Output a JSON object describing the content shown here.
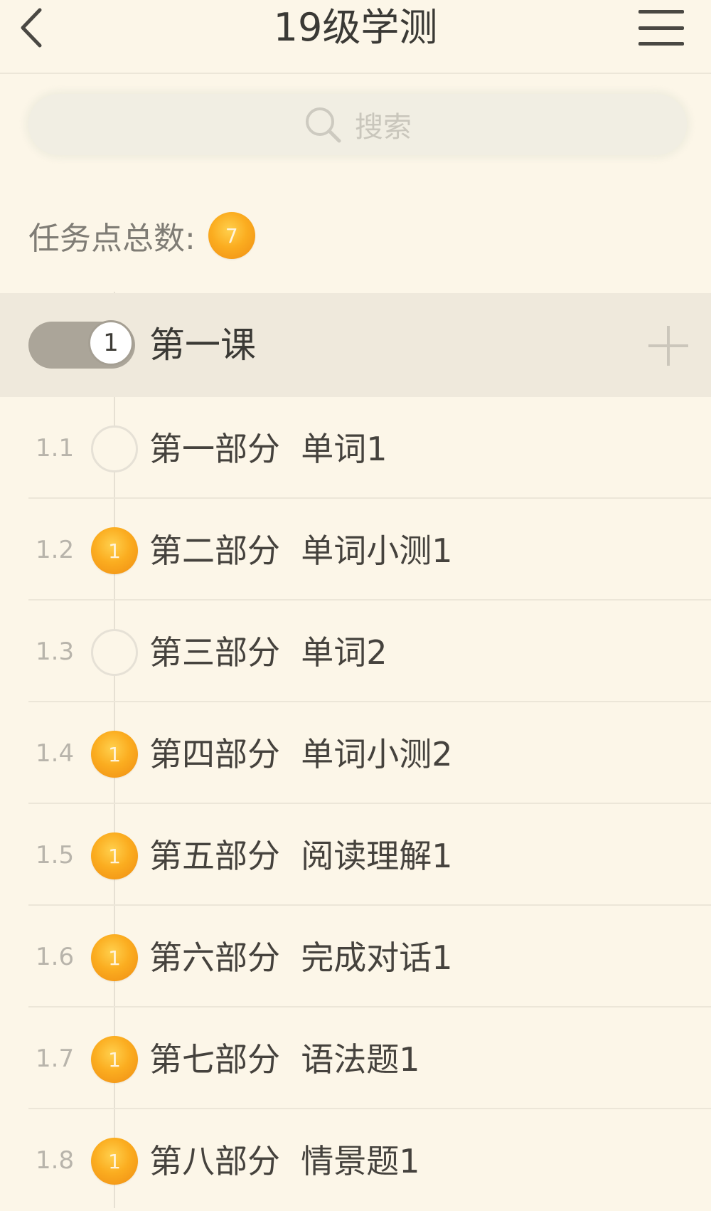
{
  "header": {
    "title": "19级学测",
    "back_icon": "chevron-left-icon",
    "menu_icon": "hamburger-menu-icon"
  },
  "search": {
    "placeholder": "搜索",
    "icon": "search-icon"
  },
  "task_total": {
    "label": "任务点总数:",
    "count": "7"
  },
  "chapter": {
    "number": "1",
    "title": "第一课",
    "expanded": true,
    "add_icon": "plus-icon"
  },
  "lessons": [
    {
      "num": "1.1",
      "title": "第一部分  单词1",
      "task": false,
      "badge": ""
    },
    {
      "num": "1.2",
      "title": "第二部分  单词小测1",
      "task": true,
      "badge": "1"
    },
    {
      "num": "1.3",
      "title": "第三部分  单词2",
      "task": false,
      "badge": ""
    },
    {
      "num": "1.4",
      "title": "第四部分  单词小测2",
      "task": true,
      "badge": "1"
    },
    {
      "num": "1.5",
      "title": "第五部分  阅读理解1",
      "task": true,
      "badge": "1"
    },
    {
      "num": "1.6",
      "title": "第六部分  完成对话1",
      "task": true,
      "badge": "1"
    },
    {
      "num": "1.7",
      "title": "第七部分  语法题1",
      "task": true,
      "badge": "1"
    },
    {
      "num": "1.8",
      "title": "第八部分  情景题1",
      "task": true,
      "badge": "1"
    }
  ],
  "colors": {
    "background": "#fcf6e8",
    "badge_orange": "#fbad20",
    "chapter_bg": "#efe9dc",
    "divider": "#ece6d8"
  }
}
